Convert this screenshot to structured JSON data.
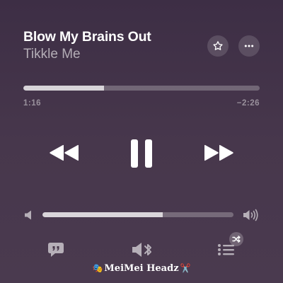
{
  "now_playing": {
    "title": "Blow My Brains Out",
    "artist": "Tikkle Me"
  },
  "header_buttons": {
    "favorite_icon": "star-icon",
    "more_icon": "ellipsis-icon"
  },
  "progress": {
    "elapsed": "1:16",
    "remaining": "−2:26",
    "fraction": 0.34
  },
  "transport": {
    "rewind_icon": "rewind-icon",
    "play_pause_icon": "pause-icon",
    "forward_icon": "fast-forward-icon"
  },
  "volume": {
    "level": 0.63,
    "low_icon": "speaker-low-icon",
    "high_icon": "speaker-high-icon"
  },
  "bottom_bar": {
    "lyrics_icon": "lyrics-quote-icon",
    "output_icon": "speaker-bluetooth-icon",
    "queue_icon": "queue-list-icon",
    "shuffle_badge_icon": "shuffle-icon"
  },
  "watermark": {
    "text": "MeiMei Headz",
    "left_emoji": "🎭",
    "right_emoji": "✂️"
  },
  "colors": {
    "background_top": "#3d2e45",
    "background_bottom": "#4a3a4f",
    "text_primary": "#ffffff",
    "text_secondary": "rgba(255,255,255,0.6)"
  }
}
